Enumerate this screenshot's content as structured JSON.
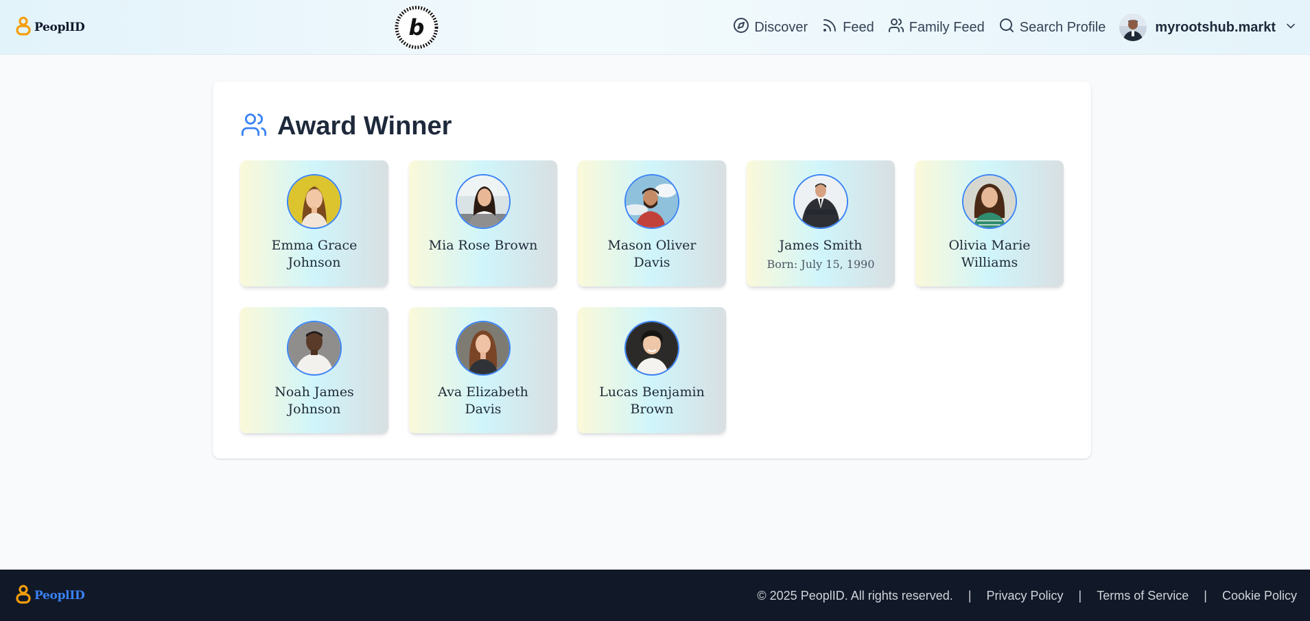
{
  "header": {
    "logo_text": "PeoplID",
    "badge_icon": "bolt-badge-icon",
    "badge_letter": "b",
    "nav": [
      {
        "label": "Discover",
        "icon": "compass-icon"
      },
      {
        "label": "Feed",
        "icon": "rss-icon"
      },
      {
        "label": "Family Feed",
        "icon": "users-icon"
      },
      {
        "label": "Search Profile",
        "icon": "search-icon"
      }
    ],
    "user": {
      "name": "myrootshub.markt",
      "icon": "chevron-down-icon"
    }
  },
  "main": {
    "title": "Award Winner",
    "title_icon": "users-icon",
    "people": [
      {
        "name": "Emma Grace Johnson",
        "born": ""
      },
      {
        "name": "Mia Rose Brown",
        "born": ""
      },
      {
        "name": "Mason Oliver Davis",
        "born": ""
      },
      {
        "name": "James Smith",
        "born": "Born: July 15, 1990"
      },
      {
        "name": "Olivia Marie Williams",
        "born": ""
      },
      {
        "name": "Noah James Johnson",
        "born": ""
      },
      {
        "name": "Ava Elizabeth Davis",
        "born": ""
      },
      {
        "name": "Lucas Benjamin Brown",
        "born": ""
      }
    ]
  },
  "footer": {
    "logo_text": "PeoplID",
    "copyright": "© 2025 PeoplID. All rights reserved.",
    "separator": "|",
    "links": [
      "Privacy Policy",
      "Terms of Service",
      "Cookie Policy"
    ]
  },
  "colors": {
    "accent": "#3b82f6",
    "logo_gold": "#f59e0b",
    "footer_bg": "#111827"
  }
}
